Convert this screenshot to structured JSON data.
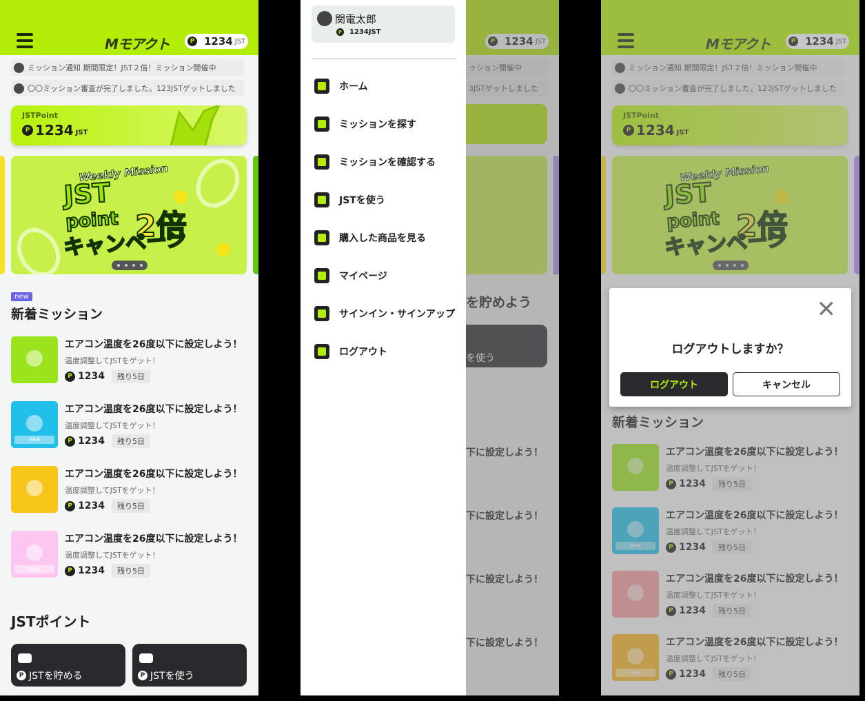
{
  "app": {
    "logo": "Mモアクト",
    "points": "1234",
    "points_unit": "JST",
    "coin": "P"
  },
  "notices": [
    "ミッション通知 期間限定！JST２倍！ミッション開催中",
    "〇〇ミッション審査が完了しました。123JSTゲットしました"
  ],
  "point_card": {
    "label": "JSTPoint",
    "value": "1234",
    "unit": "JST"
  },
  "banner": {
    "line1": "Weekly Mission",
    "line2": "JST",
    "line3": "point",
    "mult": "2倍",
    "line4": "キャンペーン"
  },
  "missions_section": {
    "tag": "new",
    "title": "新着ミッション"
  },
  "missions": [
    {
      "title": "エアコン温度を26度以下に設定しよう！",
      "sub": "温度調整してJSTをゲット！",
      "points": "1234",
      "days": "残り5日",
      "color": "#9be31c",
      "new": ""
    },
    {
      "title": "エアコン温度を26度以下に設定しよう！",
      "sub": "温度調整してJSTをゲット！",
      "points": "1234",
      "days": "残り5日",
      "color": "#22bfea",
      "new": "new"
    },
    {
      "title": "エアコン温度を26度以下に設定しよう！",
      "sub": "温度調整してJSTをゲット！",
      "points": "1234",
      "days": "残り5日",
      "color": "#f8c61a",
      "new": ""
    },
    {
      "title": "エアコン温度を26度以下に設定しよう！",
      "sub": "温度調整してJSTをゲット！",
      "points": "1234",
      "days": "残り5日",
      "color": "#fbc7f0",
      "new": "new"
    }
  ],
  "jst_section": {
    "title": "JSTポイント",
    "save": "JSTを貯める",
    "use": "JSTを使う"
  },
  "menu": {
    "user_name": "関電太郎",
    "user_points": "1234JST",
    "items": [
      "ホーム",
      "ミッションを探す",
      "ミッションを確認する",
      "JSTを使う",
      "購入した商品を見る",
      "マイページ",
      "サインイン・サインアップ",
      "ログアウト"
    ],
    "peek": {
      "notice1": "ッション開催中",
      "notice2": "3JSTゲットしました",
      "section": "を貯めよう",
      "use": "を使う",
      "mission": "下に設定しよう！"
    }
  },
  "dialog": {
    "close": "✕",
    "question": "ログアウトしますか？",
    "confirm": "ログアウト",
    "cancel": "キャンセル"
  },
  "missions_dim": [
    {
      "color": "#9be31c"
    },
    {
      "color": "#22bfea"
    },
    {
      "color": "#f29a9a"
    },
    {
      "color": "#f8b224"
    }
  ]
}
